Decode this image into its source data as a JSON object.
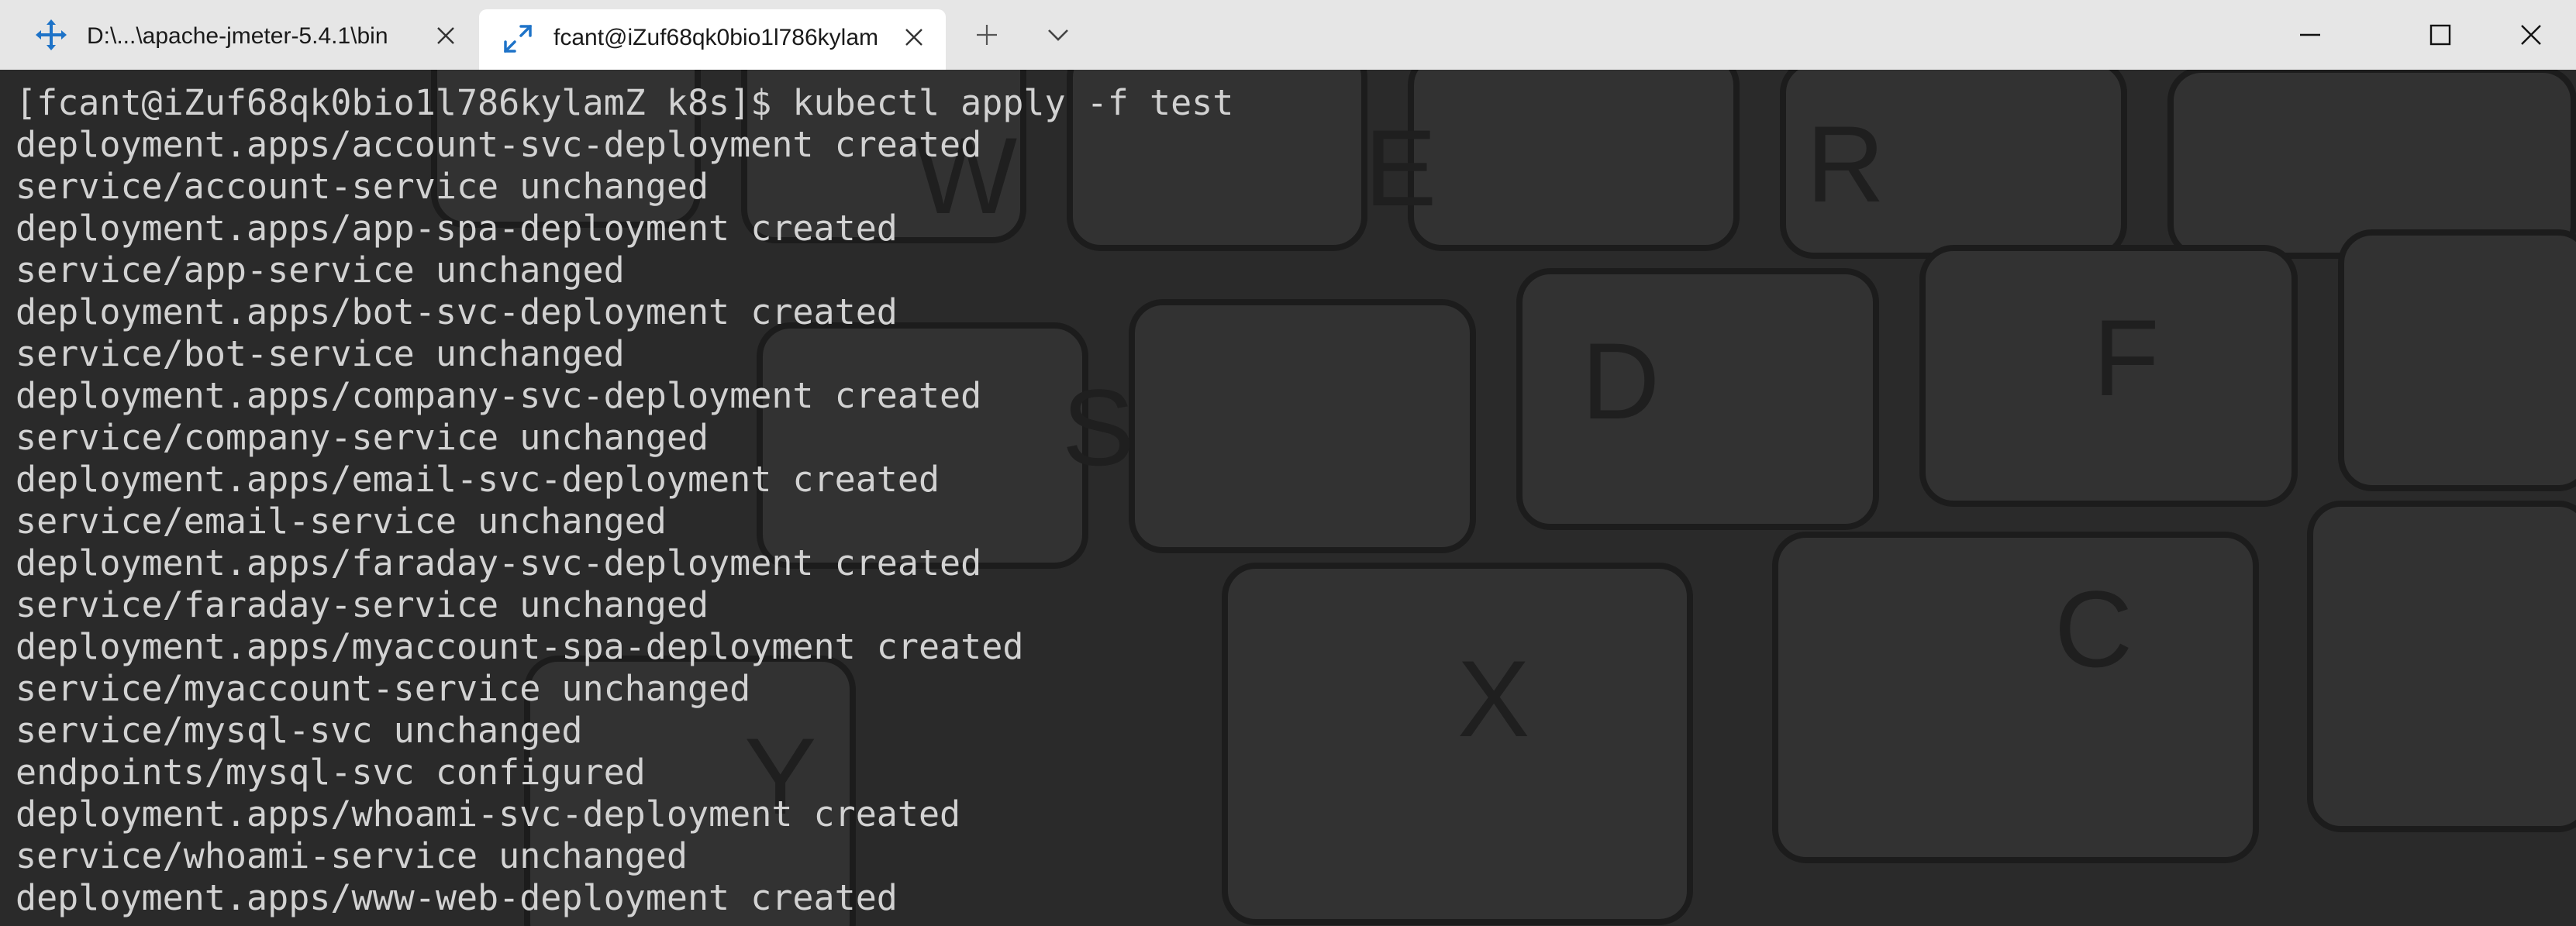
{
  "tabs": [
    {
      "title": "D:\\...\\apache-jmeter-5.4.1\\bin",
      "icon": "cmd-move-icon",
      "active": false
    },
    {
      "title": "fcant@iZuf68qk0bio1l786kylam",
      "icon": "expand-arrows-icon",
      "active": true
    }
  ],
  "titlebar": {
    "new_tab_icon": "plus-icon",
    "dropdown_icon": "chevron-down-icon",
    "window_controls": [
      "minimize-icon",
      "maximize-icon",
      "close-icon"
    ]
  },
  "terminal": {
    "lines": [
      "[fcant@iZuf68qk0bio1l786kylamZ k8s]$ kubectl apply -f test",
      "deployment.apps/account-svc-deployment created",
      "service/account-service unchanged",
      "deployment.apps/app-spa-deployment created",
      "service/app-service unchanged",
      "deployment.apps/bot-svc-deployment created",
      "service/bot-service unchanged",
      "deployment.apps/company-svc-deployment created",
      "service/company-service unchanged",
      "deployment.apps/email-svc-deployment created",
      "service/email-service unchanged",
      "deployment.apps/faraday-svc-deployment created",
      "service/faraday-service unchanged",
      "deployment.apps/myaccount-spa-deployment created",
      "service/myaccount-service unchanged",
      "service/mysql-svc unchanged",
      "endpoints/mysql-svc configured",
      "deployment.apps/whoami-svc-deployment created",
      "service/whoami-service unchanged",
      "deployment.apps/www-web-deployment created"
    ],
    "colors": {
      "text": "#d2d2d2",
      "background": "#2b2b2b",
      "accent": "#0078d4"
    }
  }
}
